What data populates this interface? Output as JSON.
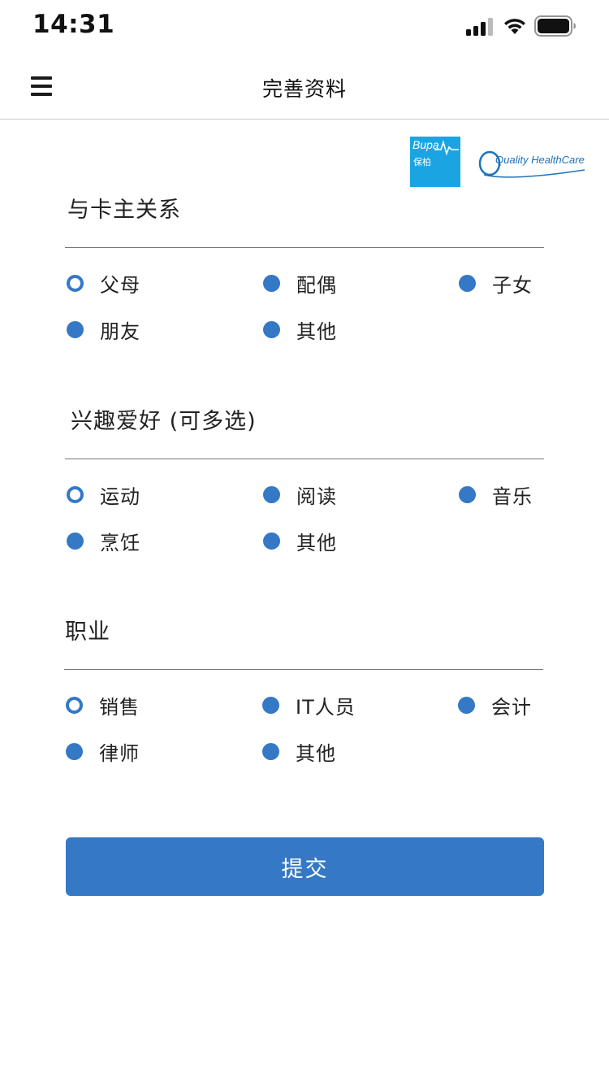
{
  "status_bar": {
    "time": "14:31"
  },
  "nav": {
    "title": "完善资料"
  },
  "logos": {
    "bupa_en": "Bupa",
    "bupa_cn": "保柏",
    "qhc": "Quality HealthCare"
  },
  "colors": {
    "accent": "#3478c6",
    "bupa": "#1aa5e2"
  },
  "sections": [
    {
      "title": "与卡主关系",
      "options": [
        {
          "label": "父母",
          "selected": true
        },
        {
          "label": "配偶",
          "selected": false
        },
        {
          "label": "子女",
          "selected": false
        },
        {
          "label": "朋友",
          "selected": false
        },
        {
          "label": "其他",
          "selected": false
        }
      ]
    },
    {
      "title": "兴趣爱好 (可多选)",
      "options": [
        {
          "label": "运动",
          "selected": true
        },
        {
          "label": "阅读",
          "selected": false
        },
        {
          "label": "音乐",
          "selected": false
        },
        {
          "label": "烹饪",
          "selected": false
        },
        {
          "label": "其他",
          "selected": false
        }
      ]
    },
    {
      "title": "职业",
      "options": [
        {
          "label": "销售",
          "selected": true
        },
        {
          "label": "IT人员",
          "selected": false
        },
        {
          "label": "会计",
          "selected": false
        },
        {
          "label": "律师",
          "selected": false
        },
        {
          "label": "其他",
          "selected": false
        }
      ]
    }
  ],
  "submit": {
    "label": "提交"
  }
}
